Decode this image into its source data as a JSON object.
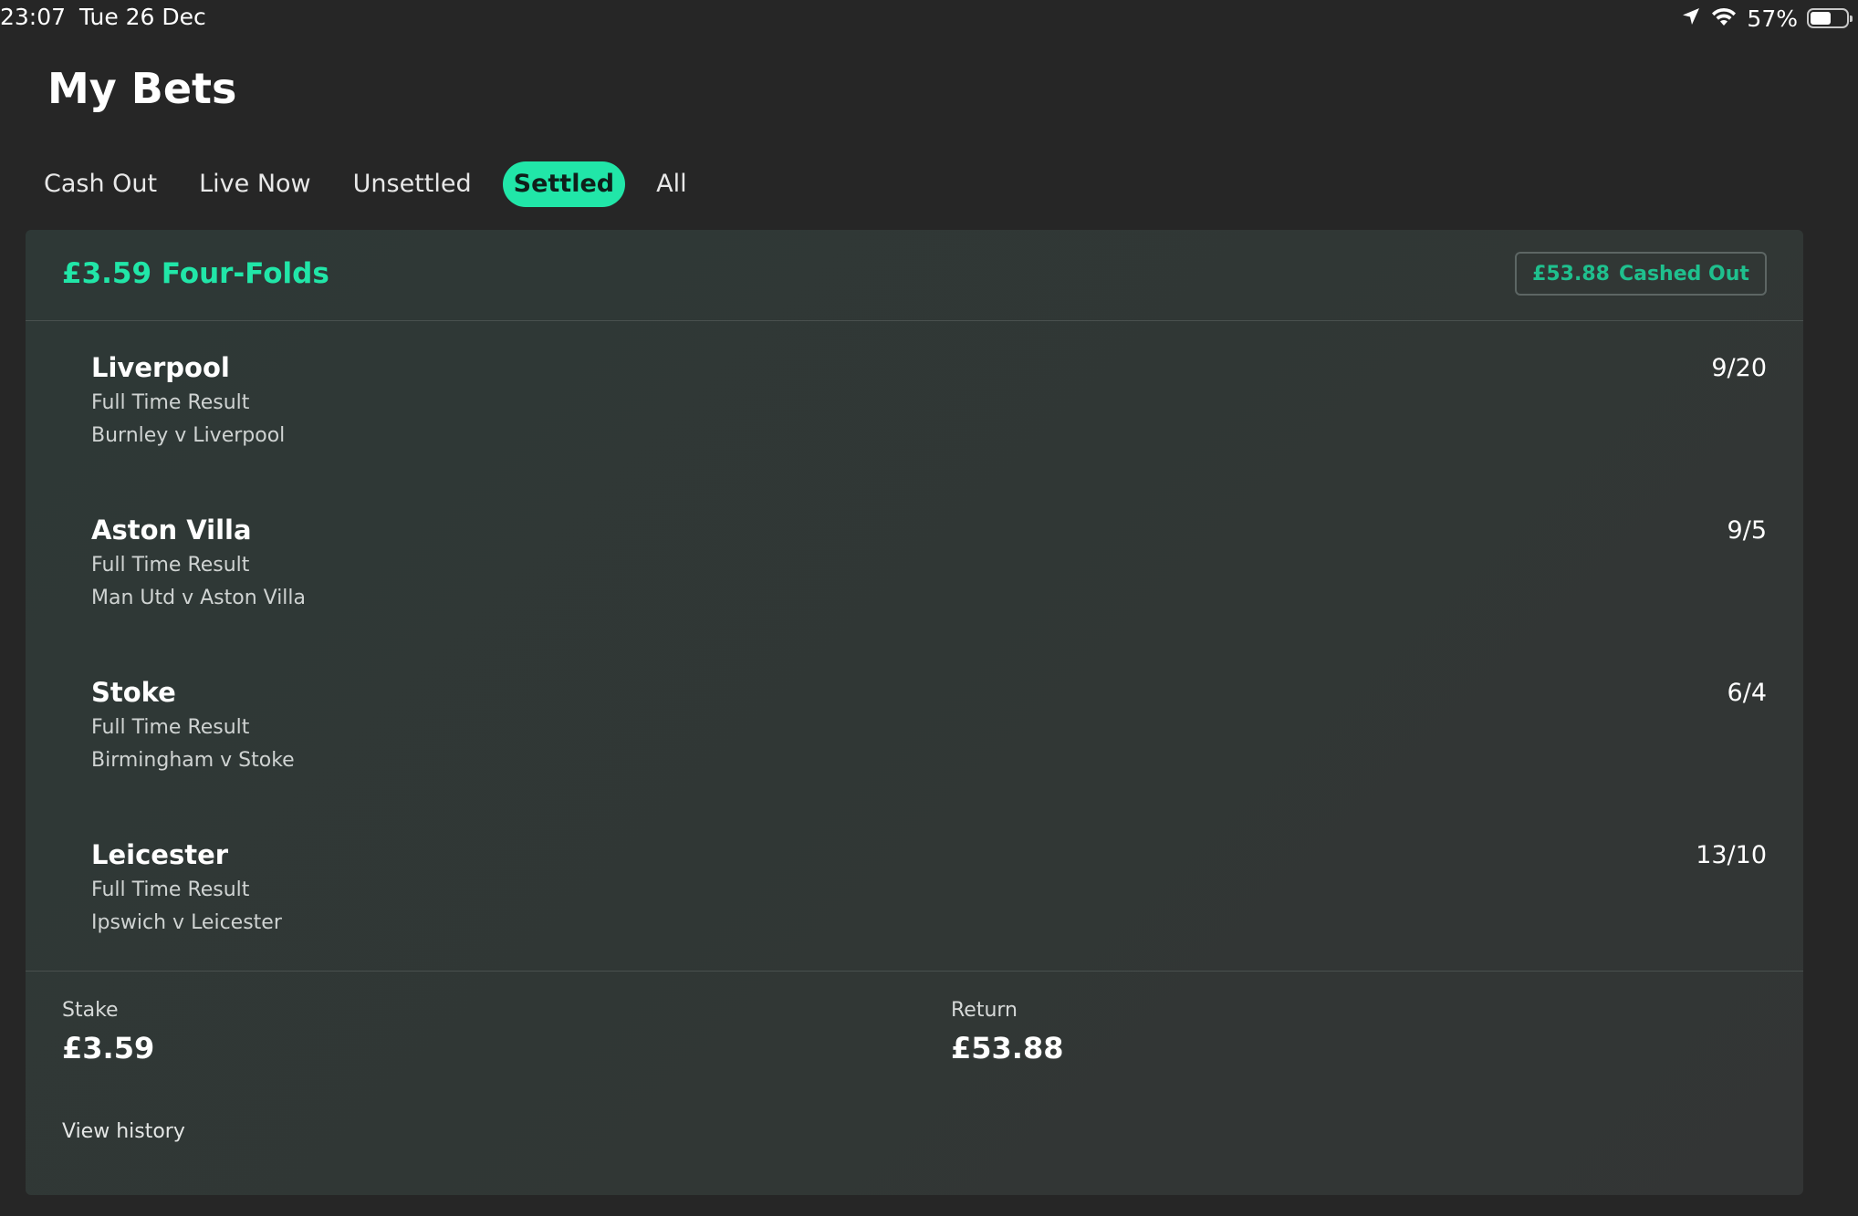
{
  "status_bar": {
    "time": "23:07",
    "date": "Tue 26 Dec",
    "battery_percent": "57%",
    "battery_level": 0.57
  },
  "header": {
    "title": "My Bets"
  },
  "tabs": [
    {
      "label": "Cash Out",
      "active": false
    },
    {
      "label": "Live Now",
      "active": false
    },
    {
      "label": "Unsettled",
      "active": false
    },
    {
      "label": "Settled",
      "active": true
    },
    {
      "label": "All",
      "active": false
    }
  ],
  "bet": {
    "title": "£3.59 Four-Folds",
    "cashed_out_amount": "£53.88",
    "cashed_out_label": "Cashed Out",
    "selections": [
      {
        "team": "Liverpool",
        "market": "Full Time Result",
        "event": "Burnley v Liverpool",
        "odds": "9/20"
      },
      {
        "team": "Aston Villa",
        "market": "Full Time Result",
        "event": "Man Utd v Aston Villa",
        "odds": "9/5"
      },
      {
        "team": "Stoke",
        "market": "Full Time Result",
        "event": "Birmingham v Stoke",
        "odds": "6/4"
      },
      {
        "team": "Leicester",
        "market": "Full Time Result",
        "event": "Ipswich v Leicester",
        "odds": "13/10"
      }
    ],
    "stake_label": "Stake",
    "stake_value": "£3.59",
    "return_label": "Return",
    "return_value": "£53.88",
    "view_history_label": "View history"
  },
  "colors": {
    "background": "#262626",
    "card": "#313735",
    "accent": "#21e6a8",
    "badge_text": "#1fc08e"
  }
}
